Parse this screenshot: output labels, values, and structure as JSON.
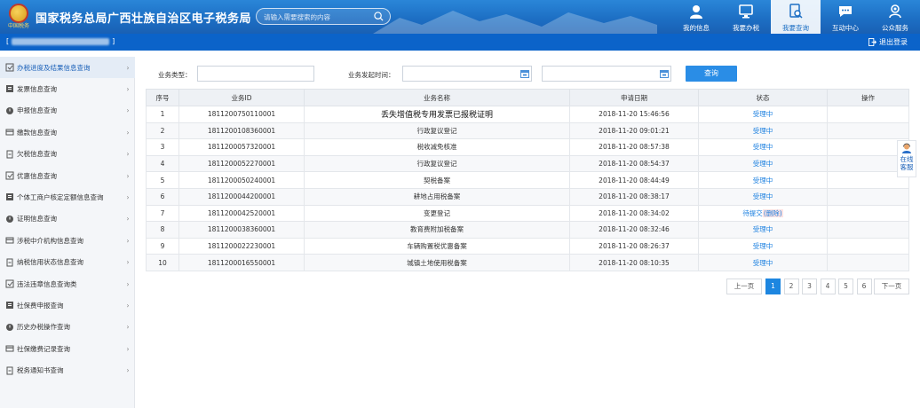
{
  "header": {
    "emblem_caption": "中国税务",
    "title": "国家税务总局广西壮族自治区电子税务局",
    "search_placeholder": "请输入需要搜索的内容",
    "nav": [
      {
        "label": "我的信息",
        "icon": "user-icon"
      },
      {
        "label": "我要办税",
        "icon": "monitor-icon"
      },
      {
        "label": "我要查询",
        "icon": "search-doc-icon",
        "active": true
      },
      {
        "label": "互动中心",
        "icon": "chat-icon"
      },
      {
        "label": "公众服务",
        "icon": "service-icon"
      }
    ]
  },
  "subbar": {
    "user_open": "[",
    "user_close": "]",
    "logout": "退出登录"
  },
  "sidebar": [
    {
      "label": "办税进度及结果信息查询",
      "icon": "progress-icon",
      "active": true
    },
    {
      "label": "发票信息查询",
      "icon": "invoice-icon"
    },
    {
      "label": "申报信息查询",
      "icon": "declare-icon"
    },
    {
      "label": "缴款信息查询",
      "icon": "payment-icon"
    },
    {
      "label": "欠税信息查询",
      "icon": "arrears-icon"
    },
    {
      "label": "优惠信息查询",
      "icon": "discount-icon"
    },
    {
      "label": "个体工商户核定定额信息查询",
      "icon": "quota-icon"
    },
    {
      "label": "证明信息查询",
      "icon": "certificate-icon"
    },
    {
      "label": "涉税中介机构信息查询",
      "icon": "agency-icon"
    },
    {
      "label": "纳税信用状态信息查询",
      "icon": "credit-icon"
    },
    {
      "label": "违法违章信息查询类",
      "icon": "violation-icon"
    },
    {
      "label": "社保费申报查询",
      "icon": "social-declare-icon"
    },
    {
      "label": "历史办税操作查询",
      "icon": "history-icon"
    },
    {
      "label": "社保缴费记录查询",
      "icon": "social-pay-icon"
    },
    {
      "label": "税务通知书查询",
      "icon": "notice-icon"
    }
  ],
  "filter": {
    "type_label": "业务类型：",
    "type_value": "",
    "time_label": "业务发起时间：",
    "start_value": "",
    "end_value": "",
    "query_label": "查询"
  },
  "table": {
    "headers": [
      "序号",
      "业务ID",
      "业务名称",
      "申请日期",
      "状态",
      "操作"
    ],
    "rows": [
      {
        "no": "1",
        "id": "1811200750110001",
        "name": "丢失增值税专用发票已报税证明",
        "date": "2018-11-20 15:46:56",
        "status": "受理中",
        "extra": ""
      },
      {
        "no": "2",
        "id": "1811200108360001",
        "name": "行政复议登记",
        "date": "2018-11-20 09:01:21",
        "status": "受理中",
        "extra": ""
      },
      {
        "no": "3",
        "id": "1811200057320001",
        "name": "税收减免核准",
        "date": "2018-11-20 08:57:38",
        "status": "受理中",
        "extra": ""
      },
      {
        "no": "4",
        "id": "1811200052270001",
        "name": "行政复议登记",
        "date": "2018-11-20 08:54:37",
        "status": "受理中",
        "extra": ""
      },
      {
        "no": "5",
        "id": "1811200050240001",
        "name": "契税备案",
        "date": "2018-11-20 08:44:49",
        "status": "受理中",
        "extra": ""
      },
      {
        "no": "6",
        "id": "1811200044200001",
        "name": "耕地占用税备案",
        "date": "2018-11-20 08:38:17",
        "status": "受理中",
        "extra": ""
      },
      {
        "no": "7",
        "id": "1811200042520001",
        "name": "变更登记",
        "date": "2018-11-20 08:34:02",
        "status": "待提交",
        "extra": "(删除)"
      },
      {
        "no": "8",
        "id": "1811200038360001",
        "name": "教育费附加税备案",
        "date": "2018-11-20 08:32:46",
        "status": "受理中",
        "extra": ""
      },
      {
        "no": "9",
        "id": "1811200022230001",
        "name": "车辆购置税优惠备案",
        "date": "2018-11-20 08:26:37",
        "status": "受理中",
        "extra": ""
      },
      {
        "no": "10",
        "id": "1811200016550001",
        "name": "城镇土地使用税备案",
        "date": "2018-11-20 08:10:35",
        "status": "受理中",
        "extra": ""
      }
    ]
  },
  "pager": {
    "prev": "上一页",
    "pages": [
      "1",
      "2",
      "3",
      "4",
      "5",
      "6"
    ],
    "current": "1",
    "next": "下一页"
  },
  "kefu": {
    "line1": "在线",
    "line2": "客服"
  },
  "colors": {
    "header_blue": "#1d6fc4",
    "subbar_blue": "#0b63c9",
    "link_blue": "#2a6fc9",
    "danger_red": "#e03030"
  }
}
